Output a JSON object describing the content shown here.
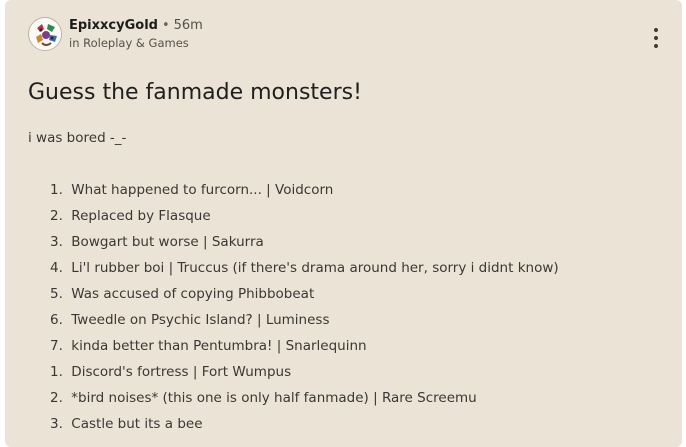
{
  "post": {
    "author": "EpixxcyGold",
    "separator": "•",
    "time": "56m",
    "community_prefix": "in",
    "community": "Roleplay & Games",
    "title": "Guess the fanmade monsters!",
    "intro": "i was bored -_-",
    "items": [
      {
        "num": "1.",
        "text": "What happened to furcorn... | Voidcorn"
      },
      {
        "num": "2.",
        "text": "Replaced by Flasque"
      },
      {
        "num": "3.",
        "text": "Bowgart but worse | Sakurra"
      },
      {
        "num": "4.",
        "text": "Li'l rubber boi | Truccus (if there's drama around her, sorry i didnt know)"
      },
      {
        "num": "5.",
        "text": "Was accused of copying Phibbobeat"
      },
      {
        "num": "6.",
        "text": "Tweedle on Psychic Island? | Luminess"
      },
      {
        "num": "7.",
        "text": "kinda better than Pentumbra! | Snarlequinn"
      },
      {
        "num": "1.",
        "text": "Discord's fortress | Fort Wumpus"
      },
      {
        "num": "2.",
        "text": "*bird noises* (this one is only half fanmade) | Rare Screemu"
      },
      {
        "num": "3.",
        "text": "Castle but its a bee"
      }
    ]
  },
  "colors": {
    "card_background": "#ebe3d5",
    "text": "#1d1d1d",
    "muted": "#55504a"
  },
  "icons": {
    "avatar": "author-avatar",
    "more": "more-options-icon"
  }
}
